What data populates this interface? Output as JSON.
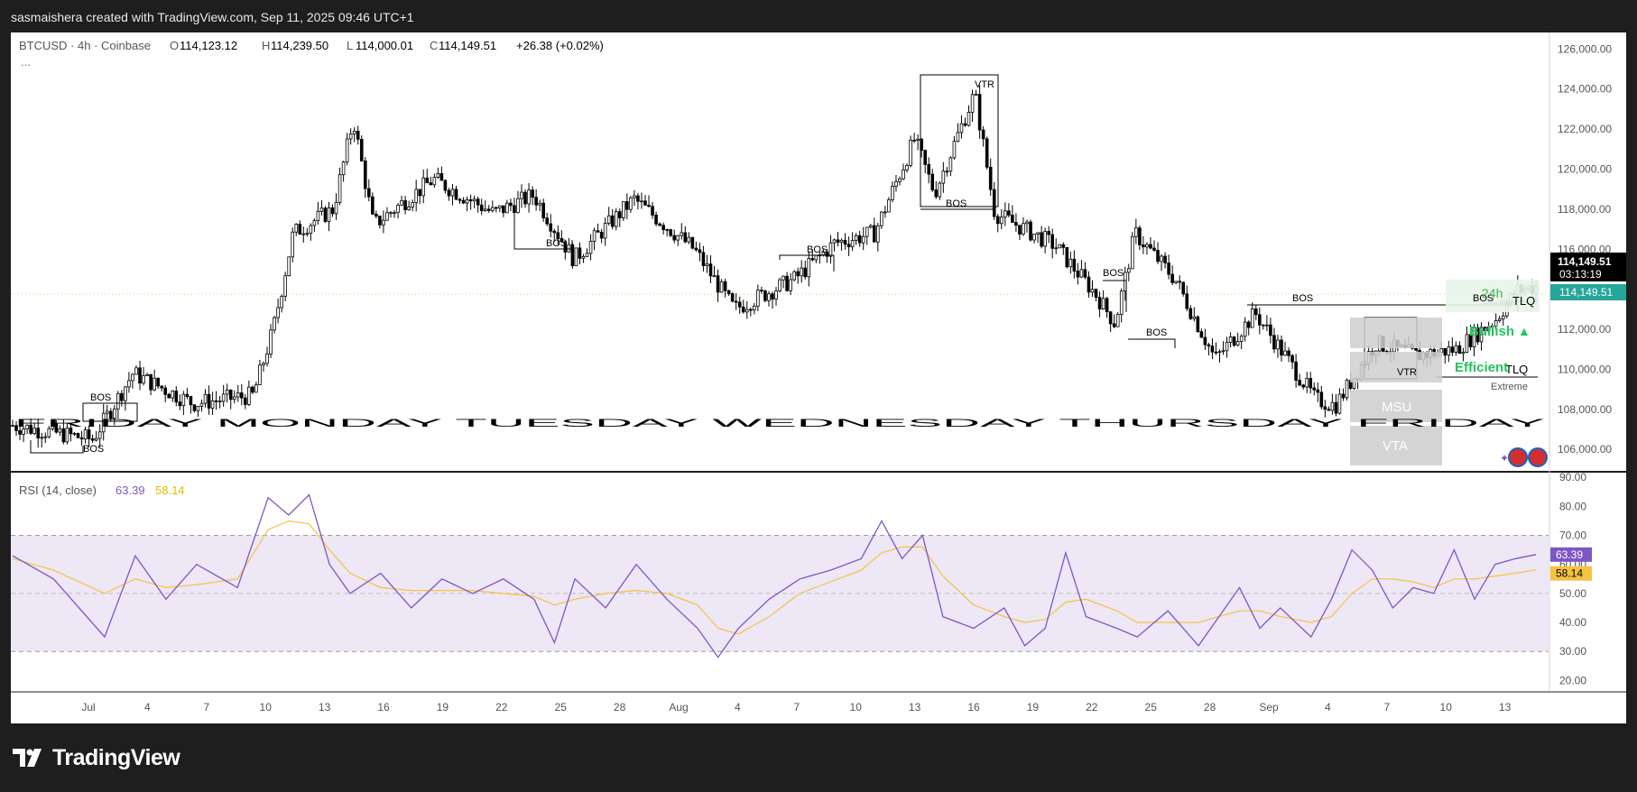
{
  "header": {
    "title": "sasmaishera created with TradingView.com, Sep 11, 2025 09:46 UTC+1"
  },
  "legend": {
    "symbol": "BTCUSD · 4h · Coinbase",
    "o_label": "O",
    "o": "114,123.12",
    "h_label": "H",
    "h": "114,239.50",
    "l_label": "L",
    "l": "114,000.01",
    "c_label": "C",
    "c": "114,149.51",
    "change": "+26.38 (+0.02%)",
    "more": "..."
  },
  "rsi_legend": {
    "label": "RSI (14, close)",
    "rsi": "63.39",
    "ma": "58.14"
  },
  "price_axis": {
    "ticks": [
      "126,000.00",
      "124,000.00",
      "122,000.00",
      "120,000.00",
      "118,000.00",
      "116,000.00",
      "114,000.00",
      "112,000.00",
      "110,000.00",
      "108,000.00",
      "106,000.00"
    ],
    "last_price": "114,149.51",
    "countdown": "03:13:19",
    "last_price_2": "114,149.51"
  },
  "rsi_axis": {
    "ticks": [
      "90.00",
      "80.00",
      "70.00",
      "60.00",
      "50.00",
      "40.00",
      "30.00",
      "20.00"
    ],
    "rsi_badge": "63.39",
    "ma_badge": "58.14"
  },
  "time_axis": {
    "labels": [
      "Jul",
      "4",
      "7",
      "10",
      "13",
      "16",
      "19",
      "22",
      "25",
      "28",
      "Aug",
      "4",
      "7",
      "10",
      "13",
      "16",
      "19",
      "22",
      "25",
      "28",
      "Sep",
      "4",
      "7",
      "10",
      "13"
    ]
  },
  "annotations": {
    "bos": [
      "BOS",
      "BOS",
      "BOS",
      "BOS",
      "BOS",
      "BOS",
      "BOS",
      "BOS",
      "BOS"
    ],
    "vtr": [
      "VTR",
      "VTR"
    ],
    "tlq": [
      "TLQ",
      "TLQ"
    ],
    "msu": "MSU",
    "vta": "VTA",
    "extreme": "Extreme",
    "efficient": "Efficient",
    "bullish": "Bullish",
    "tf": "24h",
    "day_strip": "FRIDAY MONDAY TUESDAY WEDNESDAY THURSDAY FRIDAY"
  },
  "footer": {
    "logo_text": "TradingView"
  },
  "colors": {
    "candle": "#000000",
    "rsi_line": "#7e57c2",
    "rsi_ma": "#f5c242",
    "rsi_band": "#ede7f6",
    "bull_green": "#22c55e",
    "last_price_bg": "#000000",
    "last_price_2_bg": "#26a69a",
    "rsi_badge_bg": "#7e57c2",
    "ma_badge_bg": "#f5c242"
  },
  "chart_data": [
    {
      "type": "candlestick",
      "symbol": "BTCUSD",
      "interval": "4h",
      "exchange": "Coinbase",
      "ylim": [
        105200,
        126600
      ],
      "date_range": [
        "2025-06-27",
        "2025-09-11"
      ],
      "x_ticks": [
        "Jul",
        "4",
        "7",
        "10",
        "13",
        "16",
        "19",
        "22",
        "25",
        "28",
        "Aug",
        "4",
        "7",
        "10",
        "13",
        "16",
        "19",
        "22",
        "25",
        "28",
        "Sep",
        "4",
        "7",
        "10",
        "13"
      ],
      "y_ticks": [
        106000,
        108000,
        110000,
        112000,
        114000,
        116000,
        118000,
        120000,
        122000,
        124000,
        126000
      ],
      "approx_closes": [
        {
          "date": "2025-06-27",
          "close": 107200
        },
        {
          "date": "2025-07-01",
          "close": 106500
        },
        {
          "date": "2025-07-03",
          "close": 109800
        },
        {
          "date": "2025-07-06",
          "close": 108300
        },
        {
          "date": "2025-07-09",
          "close": 108700
        },
        {
          "date": "2025-07-10",
          "close": 112000
        },
        {
          "date": "2025-07-11",
          "close": 116800
        },
        {
          "date": "2025-07-13",
          "close": 118000
        },
        {
          "date": "2025-07-14",
          "close": 122500
        },
        {
          "date": "2025-07-15",
          "close": 117200
        },
        {
          "date": "2025-07-18",
          "close": 119500
        },
        {
          "date": "2025-07-21",
          "close": 117800
        },
        {
          "date": "2025-07-23",
          "close": 118700
        },
        {
          "date": "2025-07-25",
          "close": 115500
        },
        {
          "date": "2025-07-28",
          "close": 118500
        },
        {
          "date": "2025-07-31",
          "close": 116000
        },
        {
          "date": "2025-08-02",
          "close": 113000
        },
        {
          "date": "2025-08-05",
          "close": 114500
        },
        {
          "date": "2025-08-07",
          "close": 116300
        },
        {
          "date": "2025-08-09",
          "close": 116800
        },
        {
          "date": "2025-08-11",
          "close": 121500
        },
        {
          "date": "2025-08-12",
          "close": 118800
        },
        {
          "date": "2025-08-14",
          "close": 123800
        },
        {
          "date": "2025-08-15",
          "close": 117800
        },
        {
          "date": "2025-08-18",
          "close": 116200
        },
        {
          "date": "2025-08-20",
          "close": 113800
        },
        {
          "date": "2025-08-21",
          "close": 112300
        },
        {
          "date": "2025-08-22",
          "close": 116800
        },
        {
          "date": "2025-08-24",
          "close": 114500
        },
        {
          "date": "2025-08-26",
          "close": 110500
        },
        {
          "date": "2025-08-28",
          "close": 112800
        },
        {
          "date": "2025-08-31",
          "close": 108500
        },
        {
          "date": "2025-09-01",
          "close": 108200
        },
        {
          "date": "2025-09-03",
          "close": 111300
        },
        {
          "date": "2025-09-05",
          "close": 110700
        },
        {
          "date": "2025-09-07",
          "close": 111000
        },
        {
          "date": "2025-09-09",
          "close": 112500
        },
        {
          "date": "2025-09-10",
          "close": 113900
        },
        {
          "date": "2025-09-11",
          "close": 114149.51
        }
      ],
      "last": {
        "open": 114123.12,
        "high": 114239.5,
        "low": 114000.01,
        "close": 114149.51,
        "change": 26.38,
        "change_pct": 0.02
      }
    },
    {
      "type": "line",
      "name": "RSI (14, close)",
      "ylim": [
        17,
        91
      ],
      "y_ticks": [
        20,
        30,
        40,
        50,
        60,
        70,
        80,
        90
      ],
      "bands": [
        30,
        50,
        70
      ],
      "series": [
        {
          "name": "RSI",
          "color": "#7e57c2",
          "last": 63.39,
          "values": [
            [
              0,
              63
            ],
            [
              4,
              55
            ],
            [
              9,
              35
            ],
            [
              12,
              63
            ],
            [
              15,
              48
            ],
            [
              18,
              60
            ],
            [
              22,
              52
            ],
            [
              25,
              83
            ],
            [
              27,
              77
            ],
            [
              29,
              84
            ],
            [
              31,
              60
            ],
            [
              33,
              50
            ],
            [
              36,
              57
            ],
            [
              39,
              45
            ],
            [
              42,
              55
            ],
            [
              45,
              50
            ],
            [
              48,
              55
            ],
            [
              51,
              48
            ],
            [
              53,
              33
            ],
            [
              55,
              55
            ],
            [
              58,
              45
            ],
            [
              61,
              60
            ],
            [
              64,
              48
            ],
            [
              67,
              38
            ],
            [
              69,
              28
            ],
            [
              71,
              38
            ],
            [
              74,
              48
            ],
            [
              77,
              55
            ],
            [
              80,
              58
            ],
            [
              83,
              62
            ],
            [
              85,
              75
            ],
            [
              87,
              62
            ],
            [
              89,
              70
            ],
            [
              91,
              42
            ],
            [
              94,
              38
            ],
            [
              97,
              45
            ],
            [
              99,
              32
            ],
            [
              101,
              38
            ],
            [
              103,
              64
            ],
            [
              105,
              42
            ],
            [
              108,
              38
            ],
            [
              110,
              35
            ],
            [
              113,
              44
            ],
            [
              116,
              32
            ],
            [
              118,
              42
            ],
            [
              120,
              52
            ],
            [
              122,
              38
            ],
            [
              124,
              45
            ],
            [
              127,
              35
            ],
            [
              129,
              48
            ],
            [
              131,
              65
            ],
            [
              133,
              58
            ],
            [
              135,
              45
            ],
            [
              137,
              52
            ],
            [
              139,
              50
            ],
            [
              141,
              65
            ],
            [
              143,
              48
            ],
            [
              145,
              60
            ],
            [
              147,
              62
            ],
            [
              149,
              63.39
            ]
          ]
        },
        {
          "name": "RSI-based MA",
          "color": "#f5c242",
          "last": 58.14,
          "values": [
            [
              0,
              62
            ],
            [
              4,
              58
            ],
            [
              9,
              50
            ],
            [
              12,
              55
            ],
            [
              15,
              52
            ],
            [
              18,
              53
            ],
            [
              22,
              55
            ],
            [
              25,
              72
            ],
            [
              27,
              75
            ],
            [
              29,
              74
            ],
            [
              31,
              65
            ],
            [
              33,
              57
            ],
            [
              36,
              52
            ],
            [
              39,
              51
            ],
            [
              42,
              51
            ],
            [
              45,
              51
            ],
            [
              48,
              50
            ],
            [
              51,
              49
            ],
            [
              53,
              46
            ],
            [
              55,
              48
            ],
            [
              58,
              50
            ],
            [
              61,
              51
            ],
            [
              64,
              50
            ],
            [
              67,
              46
            ],
            [
              69,
              38
            ],
            [
              71,
              36
            ],
            [
              74,
              42
            ],
            [
              77,
              50
            ],
            [
              80,
              54
            ],
            [
              83,
              58
            ],
            [
              85,
              64
            ],
            [
              87,
              66
            ],
            [
              89,
              66
            ],
            [
              91,
              56
            ],
            [
              94,
              46
            ],
            [
              97,
              42
            ],
            [
              99,
              40
            ],
            [
              101,
              41
            ],
            [
              103,
              47
            ],
            [
              105,
              48
            ],
            [
              108,
              44
            ],
            [
              110,
              40
            ],
            [
              113,
              40
            ],
            [
              116,
              40
            ],
            [
              118,
              42
            ],
            [
              120,
              44
            ],
            [
              122,
              44
            ],
            [
              124,
              42
            ],
            [
              127,
              40
            ],
            [
              129,
              42
            ],
            [
              131,
              50
            ],
            [
              133,
              55
            ],
            [
              135,
              55
            ],
            [
              137,
              54
            ],
            [
              139,
              52
            ],
            [
              141,
              55
            ],
            [
              143,
              55
            ],
            [
              145,
              56
            ],
            [
              147,
              57
            ],
            [
              149,
              58.14
            ]
          ]
        }
      ]
    }
  ]
}
